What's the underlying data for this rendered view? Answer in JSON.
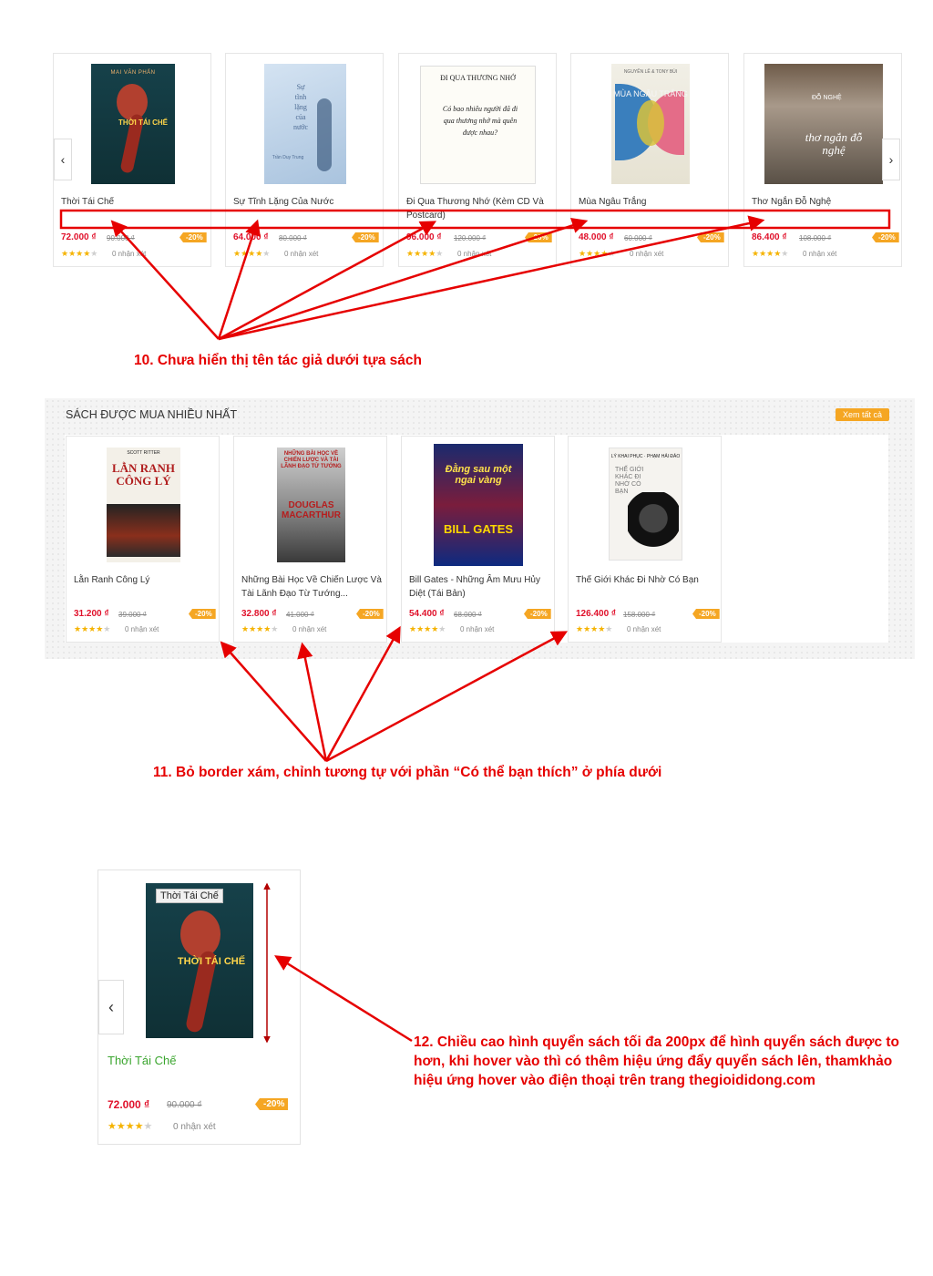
{
  "carousel": {
    "prev_icon": "chevron-left-icon",
    "next_icon": "chevron-right-icon",
    "products": [
      {
        "title": "Thời Tái Chế",
        "price": "72.000 ₫",
        "old_price": "90.000 ₫",
        "discount": "-20%",
        "rating": 4,
        "reviews": "0 nhận xét",
        "cover_text": "THỜI TÁI CHẾ",
        "cover_author": "MAI VĂN PHẤN"
      },
      {
        "title": "Sự Tĩnh Lặng Của Nước",
        "price": "64.000 ₫",
        "old_price": "80.000 ₫",
        "discount": "-20%",
        "rating": 4,
        "reviews": "0 nhận xét",
        "cover_text": "Sự tĩnh lặng của nước",
        "cover_author": "Trần Duy Trung"
      },
      {
        "title": "Đi Qua Thương Nhớ (Kèm CD Và Postcard)",
        "price": "96.000 ₫",
        "old_price": "120.000 ₫",
        "discount": "-20%",
        "rating": 4,
        "reviews": "0 nhận xét",
        "cover_text": "ĐI QUA THƯƠNG NHỚ",
        "cover_author": "Có bao nhiêu người đã đi qua thương nhớ mà quên được nhau?"
      },
      {
        "title": "Mùa Ngâu Trắng",
        "price": "48.000 ₫",
        "old_price": "60.000 ₫",
        "discount": "-20%",
        "rating": 4,
        "reviews": "0 nhận xét",
        "cover_text": "MÙA NGÂU TRẮNG",
        "cover_author": "NGUYỄN LÊ & TONY BÙI"
      },
      {
        "title": "Thơ Ngắn Đỗ Nghệ",
        "price": "86.400 ₫",
        "old_price": "108.000 ₫",
        "discount": "-20%",
        "rating": 4,
        "reviews": "0 nhận xét",
        "cover_text": "thơ ngắn đỗ nghệ",
        "cover_author": "ĐỖ NGHỆ"
      }
    ]
  },
  "annotation_10": "10. Chưa hiển thị tên tác giả dưới tựa sách",
  "bestseller": {
    "heading": "SÁCH ĐƯỢC MUA NHIỀU NHẤT",
    "view_all": "Xem tất cả",
    "products": [
      {
        "title": "Lằn Ranh Công Lý",
        "price": "31.200 ₫",
        "old_price": "39.000 ₫",
        "discount": "-20%",
        "rating": 4,
        "reviews": "0 nhận xét",
        "cover_text": "LẰN RANH CÔNG LÝ",
        "cover_author": "SCOTT RITTER"
      },
      {
        "title": "Những Bài Học Về Chiến Lược Và Tài Lãnh Đạo Từ Tướng...",
        "price": "32.800 ₫",
        "old_price": "41.000 ₫",
        "discount": "-20%",
        "rating": 4,
        "reviews": "0 nhận xét",
        "cover_text": "DOUGLAS MACARTHUR",
        "cover_author": "NHỮNG BÀI HỌC VỀ CHIẾN LƯỢC VÀ TÀI LÃNH ĐẠO TỪ TƯỚNG"
      },
      {
        "title": "Bill Gates - Những Âm Mưu Hủy Diệt (Tái Bản)",
        "price": "54.400 ₫",
        "old_price": "68.000 ₫",
        "discount": "-20%",
        "rating": 4,
        "reviews": "0 nhận xét",
        "cover_text": "BILL GATES",
        "cover_author": "Đằng sau một ngai vàng"
      },
      {
        "title": "Thế Giới Khác Đi Nhờ Có Bạn",
        "price": "126.400 ₫",
        "old_price": "158.000 ₫",
        "discount": "-20%",
        "rating": 4,
        "reviews": "0 nhận xét",
        "cover_text": "THẾ GIỚI KHÁC ĐI NHỜ CÓ BẠN",
        "cover_author": "LÝ KHAI PHỤC · PHẠM HẢI ĐẢO"
      }
    ]
  },
  "annotation_11": "11. Bỏ border xám, chỉnh tương tự với phần “Có thể bạn thích” ở phía dưới",
  "hover_demo": {
    "tooltip": "Thời Tái Chế",
    "title": "Thời Tái Chế",
    "price": "72.000 ₫",
    "old_price": "90.000 ₫",
    "discount": "-20%",
    "rating": 4,
    "reviews": "0 nhận xét",
    "cover_text": "THỜI TÁI CHẾ",
    "title_color": "#3aa52e"
  },
  "annotation_12": "12. Chiều cao hình quyển sách tối đa 200px để hình quyển sách được to hơn, khi hover vào thì có thêm hiệu ứng đẩy quyển sách lên, thamkhảo hiệu ứng hover vào điện thoại trên trang thegioididong.com",
  "colors": {
    "annotation": "#e60000",
    "price": "#e0112b",
    "badge": "#f5a623",
    "star": "#f5b301"
  }
}
